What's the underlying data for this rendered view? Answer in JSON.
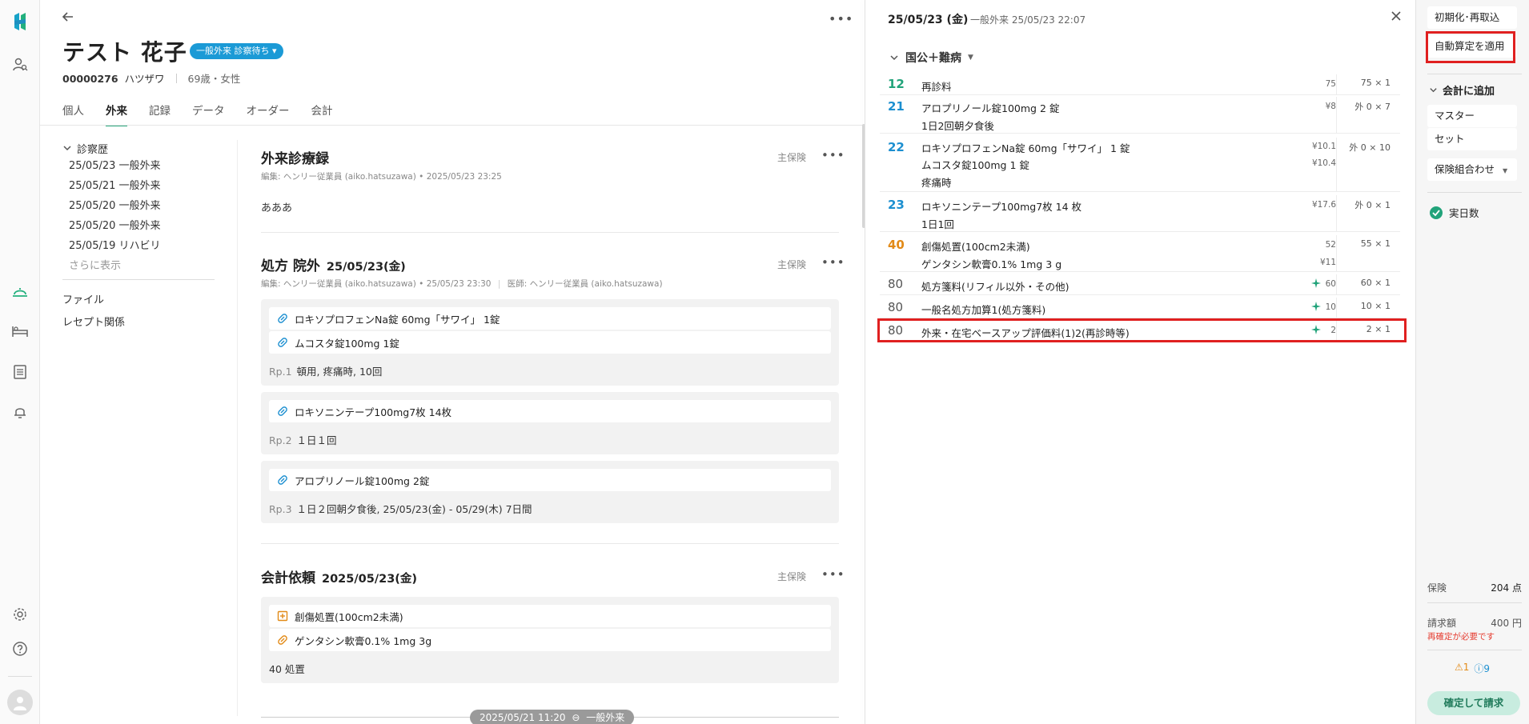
{
  "patient": {
    "name": "テスト 花子",
    "status": "一般外来 診察待ち",
    "id": "00000276",
    "kana": "ハツザワ",
    "age_sex": "69歳・女性",
    "tabs": [
      {
        "label": "個人"
      },
      {
        "label": "外来"
      },
      {
        "label": "記録"
      },
      {
        "label": "データ"
      },
      {
        "label": "オーダー"
      },
      {
        "label": "会計"
      }
    ],
    "active_tab": "外来"
  },
  "history": {
    "title": "診察歴",
    "items": [
      "25/05/23 一般外来",
      "25/05/21 一般外来",
      "25/05/20 一般外来",
      "25/05/20 一般外来",
      "25/05/19 リハビリ"
    ],
    "more": "さらに表示",
    "links": [
      "ファイル",
      "レセプト関係"
    ]
  },
  "records": {
    "medical": {
      "title": "外来診療録",
      "insurance": "主保険",
      "meta": "編集: ヘンリー従業員 (aiko.hatsuzawa) • 2025/05/23 23:25",
      "body": "あああ"
    },
    "prescription": {
      "title": "処方 院外",
      "date": "25/05/23(金)",
      "insurance": "主保険",
      "meta": "編集: ヘンリー従業員 (aiko.hatsuzawa) • 25/05/23 23:30",
      "doctor": "医師: ヘンリー従業員 (aiko.hatsuzawa)",
      "rps": [
        {
          "drugs": [
            "ロキソプロフェンNa錠 60mg「サワイ」 1錠",
            "ムコスタ錠100mg 1錠"
          ],
          "rp": "Rp.1",
          "usage": "頓用, 疼痛時, 10回"
        },
        {
          "drugs": [
            "ロキソニンテープ100mg7枚 14枚"
          ],
          "rp": "Rp.2",
          "usage": "１日１回"
        },
        {
          "drugs": [
            "アロプリノール錠100mg 2錠"
          ],
          "rp": "Rp.3",
          "usage": "１日２回朝夕食後, 25/05/23(金) - 05/29(木) 7日間"
        }
      ]
    },
    "accounting": {
      "title": "会計依頼",
      "date": "2025/05/23(金)",
      "insurance": "主保険",
      "items": [
        "創傷処置(100cm2未満)",
        "ゲンタシン軟膏0.1% 1mg 3g"
      ],
      "footer": "40 処置"
    },
    "next_divider": {
      "datetime": "2025/05/21 11:20",
      "type": "一般外来"
    }
  },
  "billing": {
    "date": "25/05/23 (金)",
    "subtitle": "一般外来 25/05/23 22:07",
    "group": "国公＋難病",
    "rows": [
      {
        "code": "12",
        "lines": [
          "再診料"
        ],
        "prices": [
          "75"
        ],
        "qty": "75 × 1",
        "auto": false
      },
      {
        "code": "21",
        "lines": [
          "アロプリノール錠100mg 2 錠",
          "1日2回朝夕食後"
        ],
        "prices": [
          "¥8"
        ],
        "qty": "外 0 × 7",
        "auto": false
      },
      {
        "code": "22",
        "lines": [
          "ロキソプロフェンNa錠 60mg「サワイ」 1 錠",
          "ムコスタ錠100mg 1 錠",
          "疼痛時"
        ],
        "prices": [
          "¥10.1",
          "¥10.4"
        ],
        "qty": "外 0 × 10",
        "auto": false
      },
      {
        "code": "23",
        "lines": [
          "ロキソニンテープ100mg7枚 14 枚",
          "1日1回"
        ],
        "prices": [
          "¥17.6"
        ],
        "qty": "外 0 × 1",
        "auto": false
      },
      {
        "code": "40",
        "lines": [
          "創傷処置(100cm2未満)",
          "ゲンタシン軟膏0.1% 1mg 3 g"
        ],
        "prices": [
          "52",
          "¥11"
        ],
        "qty": "55 × 1",
        "auto": false
      },
      {
        "code": "80",
        "lines": [
          "処方箋料(リフィル以外・その他)"
        ],
        "prices": [
          "60"
        ],
        "qty": "60 × 1",
        "auto": true
      },
      {
        "code": "80",
        "lines": [
          "一般名処方加算1(処方箋料)"
        ],
        "prices": [
          "10"
        ],
        "qty": "10 × 1",
        "auto": true
      },
      {
        "code": "80",
        "lines": [
          "外来・在宅ベースアップ評価料(1)2(再診時等)"
        ],
        "prices": [
          "2"
        ],
        "qty": "2 × 1",
        "auto": true
      }
    ],
    "colors": {
      "teal": "#21a37a",
      "blue": "#1c8fd0",
      "orange": "#e28a17",
      "highlight": "#e02020"
    }
  },
  "actions": {
    "reset": "初期化･再取込",
    "auto_apply": "自動算定を適用",
    "add_head": "会計に追加",
    "master": "マスター",
    "set": "セット",
    "combo": "保険組合わせ",
    "days": "実日数",
    "insurance_label": "保険",
    "insurance_value": "204 点",
    "claim_label": "請求額",
    "claim_value": "400 円",
    "warn": "再確定が必要です",
    "warn_count": "1",
    "info_count": "9",
    "confirm": "確定して請求"
  }
}
